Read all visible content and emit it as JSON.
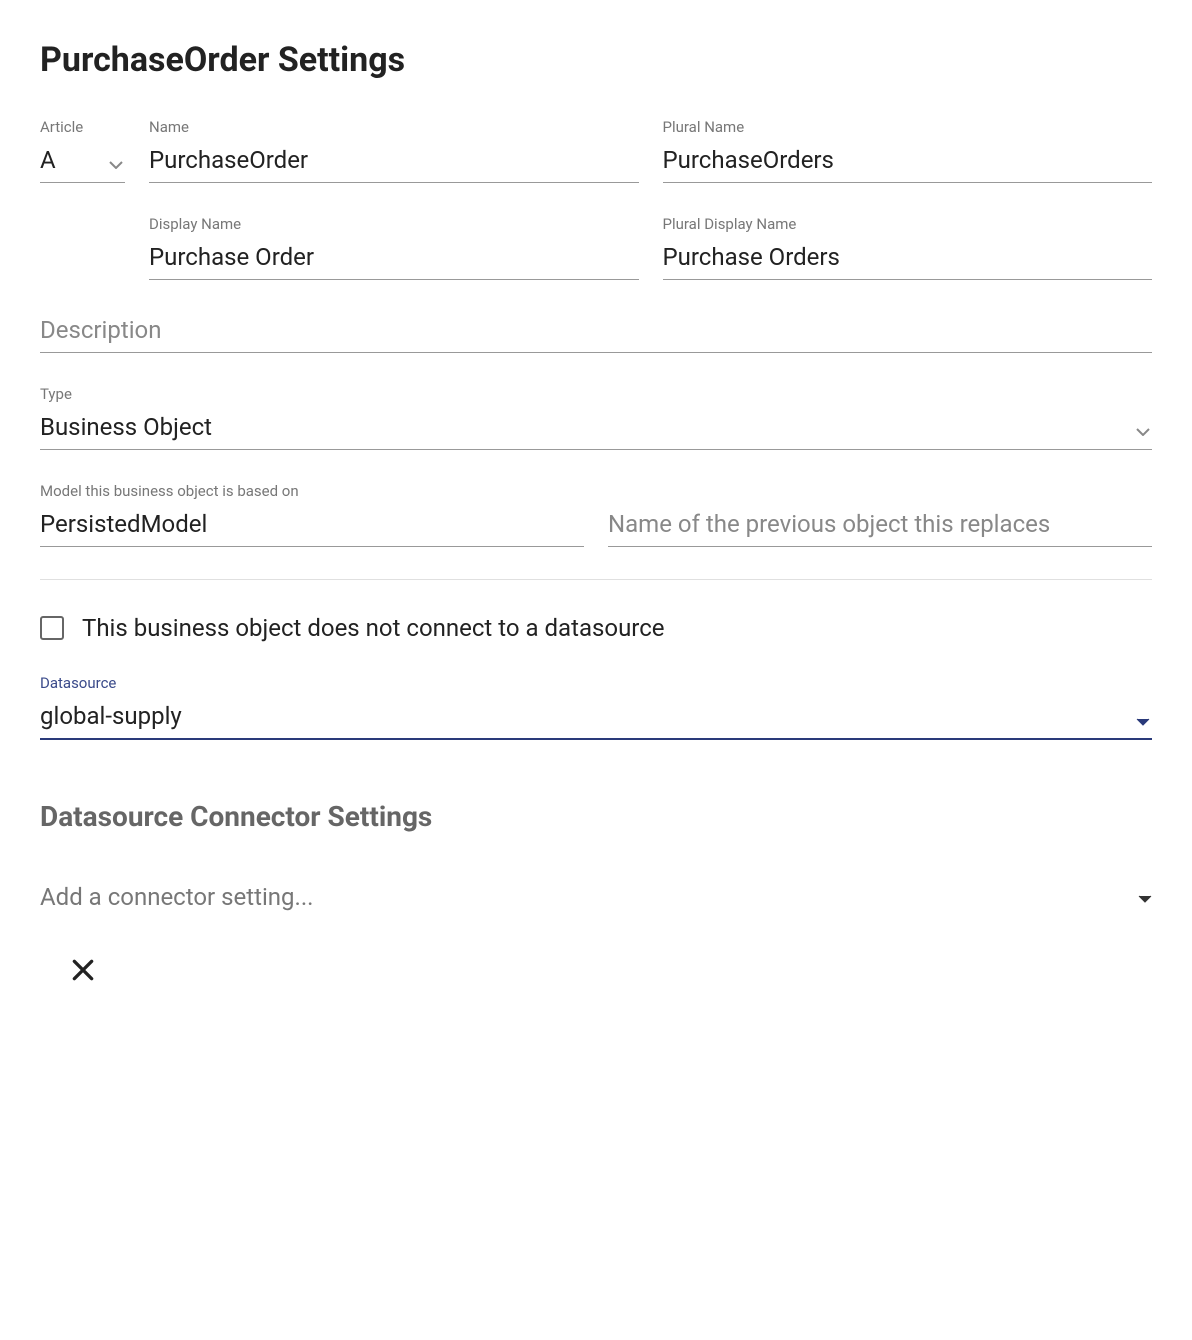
{
  "title": "PurchaseOrder Settings",
  "article": {
    "label": "Article",
    "value": "A"
  },
  "name": {
    "label": "Name",
    "value": "PurchaseOrder"
  },
  "plural_name": {
    "label": "Plural Name",
    "value": "PurchaseOrders"
  },
  "display_name": {
    "label": "Display Name",
    "value": "Purchase Order"
  },
  "plural_display_name": {
    "label": "Plural Display Name",
    "value": "Purchase Orders"
  },
  "description": {
    "placeholder": "Description",
    "value": ""
  },
  "type": {
    "label": "Type",
    "value": "Business Object"
  },
  "model": {
    "label": "Model this business object is based on",
    "value": "PersistedModel"
  },
  "replaces": {
    "placeholder": "Name of the previous object this replaces",
    "value": ""
  },
  "no_datasource_checkbox": {
    "label": "This business object does not connect to a datasource",
    "checked": false
  },
  "datasource": {
    "label": "Datasource",
    "value": "global-supply"
  },
  "connector_section": {
    "heading": "Datasource Connector Settings",
    "placeholder": "Add a connector setting..."
  }
}
